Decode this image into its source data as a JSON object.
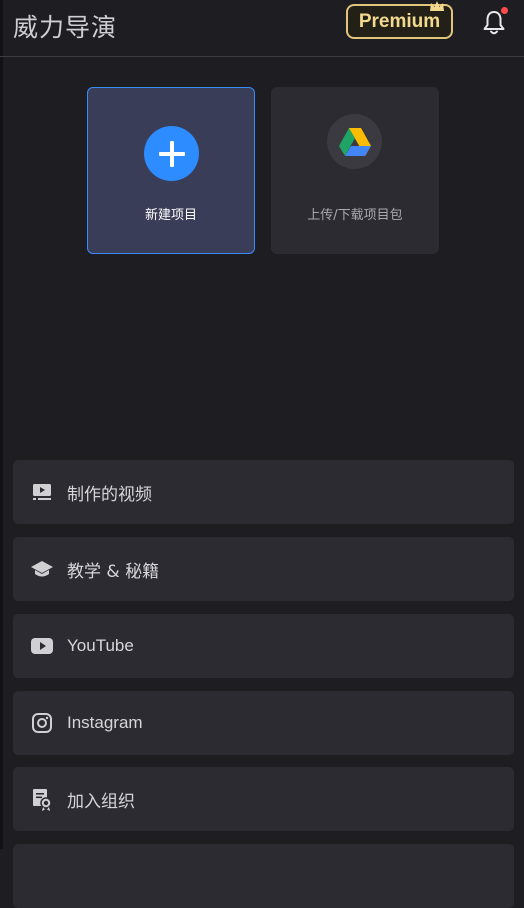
{
  "header": {
    "app_title": "威力导演",
    "premium_label": "Premium",
    "has_notification": true
  },
  "actions": [
    {
      "label": "新建项目",
      "icon": "plus-icon"
    },
    {
      "label": "上传/下载项目包",
      "icon": "google-drive-icon"
    }
  ],
  "menu": [
    {
      "label": "制作的视频",
      "icon": "produced-video-icon"
    },
    {
      "label": "教学 & 秘籍",
      "icon": "graduation-cap-icon"
    },
    {
      "label": "YouTube",
      "icon": "youtube-icon"
    },
    {
      "label": "Instagram",
      "icon": "instagram-icon"
    },
    {
      "label": "加入组织",
      "icon": "certificate-icon"
    }
  ],
  "colors": {
    "background": "#1d1d22",
    "accent_blue": "#2d8cff",
    "premium_gold": "#e1c57a",
    "notification_red": "#ff4a4a"
  }
}
